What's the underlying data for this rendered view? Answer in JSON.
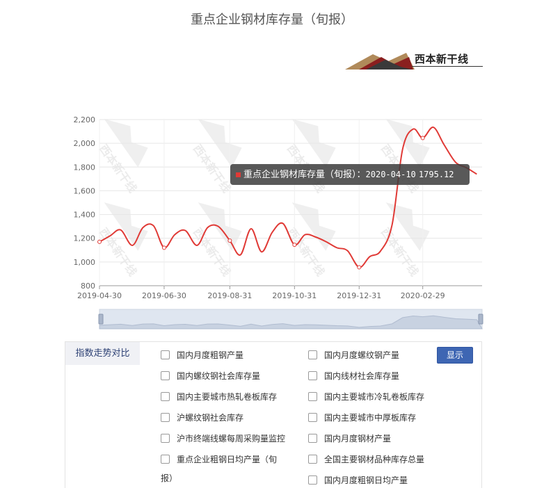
{
  "page": {
    "title": "重点企业钢材库存量（旬报）",
    "logo_text": "西本新干线",
    "logo_small_left": "XIBEN NEW LINE STOCK CO.,LTD.",
    "logo_small_right": "WWW.96369.NET"
  },
  "tooltip": {
    "series": "重点企业钢材库存量（旬报）",
    "date": "2020-04-10",
    "value": "1795.12"
  },
  "chart_data": {
    "type": "line",
    "watermark": "西本新干线",
    "x_tick_labels": [
      "2019-04-30",
      "2019-06-30",
      "2019-08-31",
      "2019-10-31",
      "2019-12-31",
      "2020-02-29"
    ],
    "y_tick_labels": [
      "800",
      "1,000",
      "1,200",
      "1,400",
      "1,600",
      "1,800",
      "2,000",
      "2,200"
    ],
    "ylim": [
      800,
      2200
    ],
    "color": "#e03a36",
    "series": [
      {
        "values": [
          [
            "2019-04-30",
            1170
          ],
          [
            "2019-05-10",
            1220
          ],
          [
            "2019-05-20",
            1270
          ],
          [
            "2019-05-31",
            1140
          ],
          [
            "2019-06-10",
            1290
          ],
          [
            "2019-06-20",
            1305
          ],
          [
            "2019-06-30",
            1120
          ],
          [
            "2019-07-10",
            1230
          ],
          [
            "2019-07-20",
            1265
          ],
          [
            "2019-07-31",
            1140
          ],
          [
            "2019-08-10",
            1290
          ],
          [
            "2019-08-20",
            1300
          ],
          [
            "2019-08-31",
            1180
          ],
          [
            "2019-09-10",
            1060
          ],
          [
            "2019-09-20",
            1280
          ],
          [
            "2019-09-30",
            1085
          ],
          [
            "2019-10-10",
            1250
          ],
          [
            "2019-10-20",
            1325
          ],
          [
            "2019-10-31",
            1145
          ],
          [
            "2019-11-10",
            1230
          ],
          [
            "2019-11-20",
            1210
          ],
          [
            "2019-11-30",
            1170
          ],
          [
            "2019-12-10",
            1120
          ],
          [
            "2019-12-20",
            1095
          ],
          [
            "2019-12-31",
            955
          ],
          [
            "2020-01-10",
            1045
          ],
          [
            "2020-01-20",
            1090
          ],
          [
            "2020-01-31",
            1310
          ],
          [
            "2020-02-10",
            1950
          ],
          [
            "2020-02-20",
            2120
          ],
          [
            "2020-02-29",
            2045
          ],
          [
            "2020-03-10",
            2135
          ],
          [
            "2020-03-20",
            1990
          ],
          [
            "2020-03-31",
            1840
          ],
          [
            "2020-04-10",
            1795.12
          ],
          [
            "2020-04-20",
            1740
          ]
        ]
      }
    ]
  },
  "panel": {
    "tab_label": "指数走势对比",
    "show_button": "显示",
    "options_left": [
      "国内月度粗钢产量",
      "国内螺纹钢社会库存量",
      "国内主要城市热轧卷板库存",
      "沪螺纹钢社会库存",
      "沪市终端线螺每周采购量监控",
      "重点企业粗钢日均产量（旬"
    ],
    "options_left_wrap": "报）",
    "options_right": [
      "国内月度螺纹钢产量",
      "国内线材社会库存量",
      "国内主要城市冷轧卷板库存",
      "国内主要城市中厚板库存",
      "国内月度钢材产量",
      "全国主要钢材品种库存总量",
      "国内月度粗钢日均产量"
    ]
  }
}
